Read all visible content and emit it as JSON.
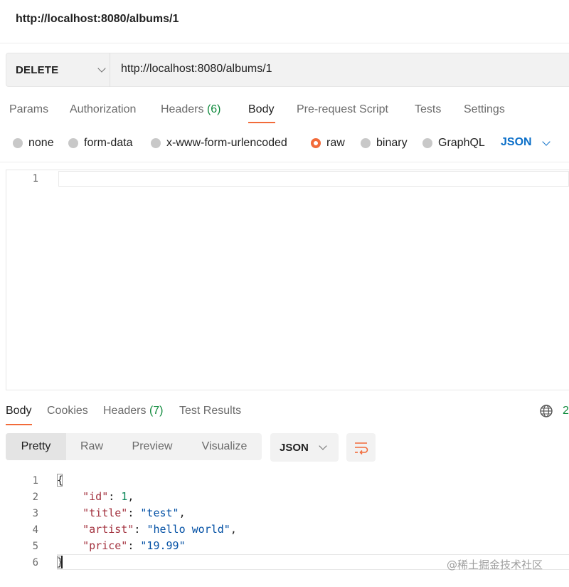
{
  "request": {
    "title_url": "http://localhost:8080/albums/1",
    "method": "DELETE",
    "url": "http://localhost:8080/albums/1",
    "tabs": [
      {
        "label": "Params"
      },
      {
        "label": "Authorization"
      },
      {
        "label": "Headers",
        "count": "(6)"
      },
      {
        "label": "Body",
        "active": true
      },
      {
        "label": "Pre-request Script"
      },
      {
        "label": "Tests"
      },
      {
        "label": "Settings"
      }
    ],
    "body_types": [
      "none",
      "form-data",
      "x-www-form-urlencoded",
      "raw",
      "binary",
      "GraphQL"
    ],
    "selected_body_type": "raw",
    "raw_format": "JSON",
    "editor_line_numbers": [
      "1"
    ]
  },
  "response": {
    "tabs": [
      {
        "label": "Body",
        "active": true
      },
      {
        "label": "Cookies"
      },
      {
        "label": "Headers",
        "count": "(7)"
      },
      {
        "label": "Test Results"
      }
    ],
    "status_partial": "2",
    "view_modes": [
      "Pretty",
      "Raw",
      "Preview",
      "Visualize"
    ],
    "selected_view": "Pretty",
    "format": "JSON",
    "line_numbers": [
      "1",
      "2",
      "3",
      "4",
      "5",
      "6"
    ],
    "json": {
      "open_brace": "{",
      "close_brace": "}",
      "id_key": "\"id\"",
      "id_value": "1",
      "title_key": "\"title\"",
      "title_value": "\"test\"",
      "artist_key": "\"artist\"",
      "artist_value": "\"hello world\"",
      "price_key": "\"price\"",
      "price_value": "\"19.99\"",
      "colon": ": ",
      "comma": ","
    }
  },
  "watermark": "@稀土掘金技术社区",
  "colors": {
    "accent": "#f26b3a",
    "json_blue": "#0a6ec8",
    "count_green": "#0f8a3c",
    "json_key": "#a3323f",
    "json_string": "#0451a5",
    "json_number": "#098658"
  }
}
